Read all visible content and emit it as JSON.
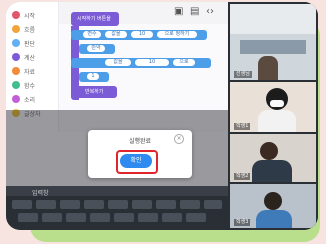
{
  "app": {
    "categories": [
      {
        "label": "시작",
        "color": "#e0566a"
      },
      {
        "label": "흐름",
        "color": "#f2a33a"
      },
      {
        "label": "판단",
        "color": "#5fb0f5"
      },
      {
        "label": "계산",
        "color": "#7c5cd6"
      },
      {
        "label": "자료",
        "color": "#f28c3a"
      },
      {
        "label": "함수",
        "color": "#3fbf8f"
      },
      {
        "label": "소리",
        "color": "#c25fd8"
      },
      {
        "label": "글상자",
        "color": "#f0c53a"
      }
    ],
    "blocks": {
      "start_label": "시작하기 버튼을",
      "row1": [
        "변수",
        "값을",
        "10",
        "으로 정하기"
      ],
      "row2": "만약",
      "row3": [
        "값을",
        "10",
        "으로"
      ],
      "row4": "1",
      "row5": "반복하기"
    }
  },
  "dialog": {
    "title": "실행완료",
    "close_glyph": "×",
    "confirm_label": "확인"
  },
  "keyboard": {
    "bar_label": "입력창"
  },
  "video": {
    "tiles": [
      {
        "name": "선생님"
      },
      {
        "name": "학생1"
      },
      {
        "name": "학생2"
      },
      {
        "name": "학생3"
      },
      {
        "name": "학생4"
      }
    ]
  },
  "colors": {
    "outer_background": "#f7e3e0",
    "green_accent": "#b9df8c",
    "frame": "#1d2328",
    "confirm_button": "#2f8bf0",
    "highlight_ring": "#e0262c",
    "block_purple": "#7c5cd6",
    "block_blue": "#4d9ee8"
  }
}
